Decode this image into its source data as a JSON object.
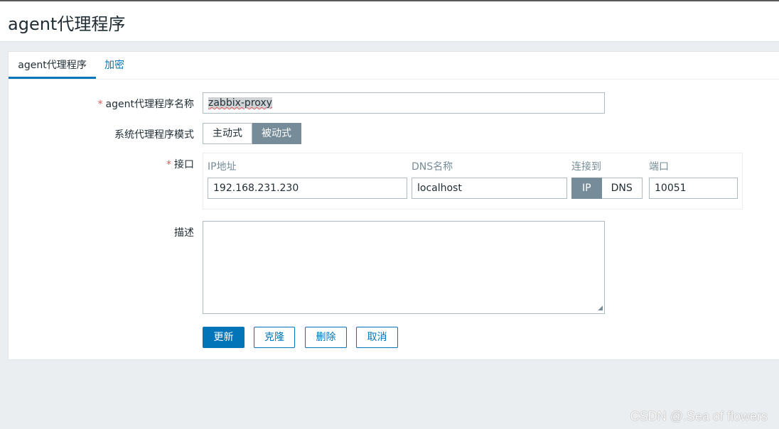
{
  "page": {
    "title": "agent代理程序"
  },
  "tabs": [
    {
      "label": "agent代理程序",
      "active": true
    },
    {
      "label": "加密",
      "active": false
    }
  ],
  "form": {
    "name": {
      "label": "agent代理程序名称",
      "required_mark": "*",
      "value": "zabbix-proxy"
    },
    "mode": {
      "label": "系统代理程序模式",
      "options": [
        "主动式",
        "被动式"
      ],
      "selected": "被动式"
    },
    "interface": {
      "label": "接口",
      "required_mark": "*",
      "headers": {
        "ip": "IP地址",
        "dns": "DNS名称",
        "connect": "连接到",
        "port": "端口"
      },
      "ip_value": "192.168.231.230",
      "dns_value": "localhost",
      "connect_options": [
        "IP",
        "DNS"
      ],
      "connect_selected": "IP",
      "port_value": "10051"
    },
    "description": {
      "label": "描述",
      "value": ""
    }
  },
  "buttons": {
    "update": "更新",
    "clone": "克隆",
    "delete": "删除",
    "cancel": "取消"
  },
  "watermark": "CSDN @.Sea of flowers",
  "colors": {
    "accent": "#0275b8",
    "selected_segment": "#768d99",
    "required": "#e45959"
  }
}
